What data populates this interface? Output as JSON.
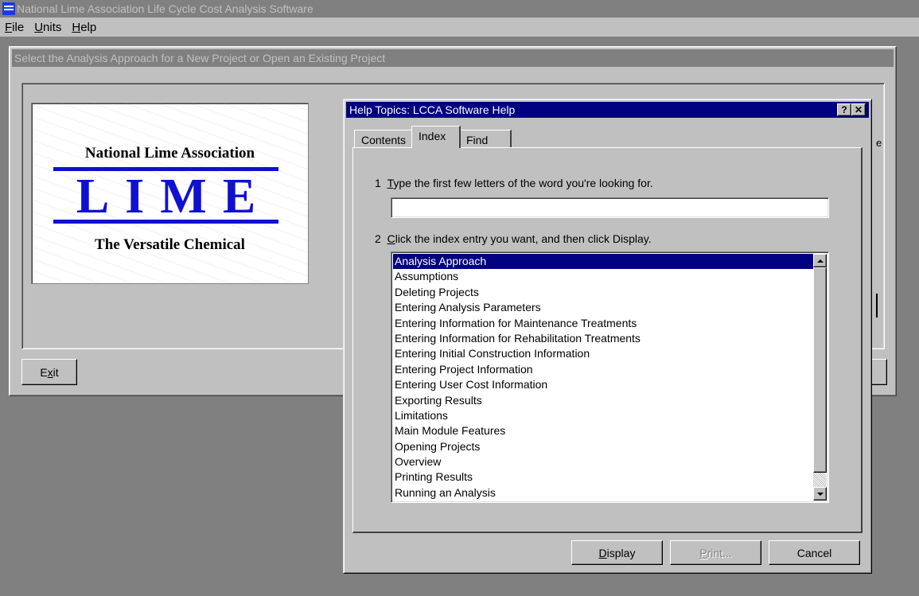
{
  "app": {
    "title": "National Lime Association Life Cycle Cost Analysis Software",
    "menu": [
      {
        "label": "File",
        "mnemonic": "F",
        "rest": "ile"
      },
      {
        "label": "Units",
        "mnemonic": "U",
        "rest": "nits"
      },
      {
        "label": "Help",
        "mnemonic": "H",
        "rest": "elp"
      }
    ]
  },
  "main_dialog": {
    "title": "Select the Analysis Approach for a New Project or Open an Existing Project",
    "exit_label_pre": "E",
    "exit_label_mnemonic": "x",
    "exit_label_post": "it",
    "hidden_char": "e"
  },
  "logo": {
    "organization": "National Lime Association",
    "word": "LIME",
    "tagline": "The Versatile Chemical",
    "brand_color": "#1010d0"
  },
  "help_dialog": {
    "title": "Help Topics: LCCA Software Help",
    "help_button": "?",
    "close_button": "✕",
    "tabs": [
      "Contents",
      "Index",
      "Find"
    ],
    "active_tab": "Index",
    "step1": {
      "number": "1",
      "mnemonic": "T",
      "text": "ype the first few letters of the word you're looking for."
    },
    "search_value": "",
    "step2": {
      "number": "2",
      "mnemonic": "C",
      "text": "lick the index entry you want, and then click Display."
    },
    "index_entries": [
      "Analysis Approach",
      "Assumptions",
      "Deleting Projects",
      "Entering Analysis Parameters",
      "Entering Information for Maintenance Treatments",
      "Entering Information for Rehabilitation Treatments",
      "Entering Initial Construction Information",
      "Entering Project Information",
      "Entering User Cost Information",
      "Exporting Results",
      "Limitations",
      "Main Module Features",
      "Opening Projects",
      "Overview",
      "Printing Results",
      "Running an Analysis"
    ],
    "selected_index": 0,
    "buttons": {
      "display": {
        "mnemonic": "D",
        "rest": "isplay"
      },
      "print": {
        "mnemonic": "P",
        "rest": "rint..."
      },
      "cancel": "Cancel"
    },
    "accent_color": "#000080"
  }
}
